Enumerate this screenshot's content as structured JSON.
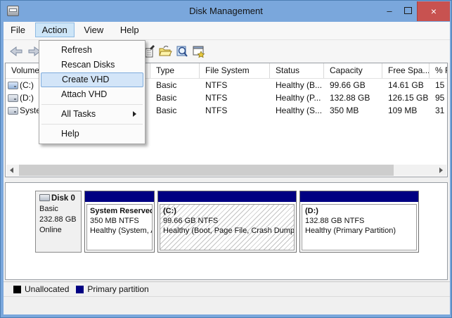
{
  "window": {
    "title": "Disk Management",
    "controls": {
      "minimize": "–",
      "maximize": "maximize-box",
      "close": "×"
    }
  },
  "menu_bar": {
    "items": [
      {
        "label": "File"
      },
      {
        "label": "Action",
        "active": true
      },
      {
        "label": "View"
      },
      {
        "label": "Help"
      }
    ]
  },
  "action_menu": {
    "items": [
      {
        "label": "Refresh"
      },
      {
        "label": "Rescan Disks"
      },
      {
        "label": "Create VHD",
        "highlighted": true
      },
      {
        "label": "Attach VHD"
      },
      {
        "label": "All Tasks",
        "has_submenu": true
      },
      {
        "label": "Help"
      }
    ]
  },
  "toolbar": {
    "icons": [
      "back-arrow",
      "forward-arrow",
      "export-list",
      "open-folder",
      "find",
      "console-window"
    ]
  },
  "volume_list": {
    "columns": {
      "volume": "Volume",
      "type": "Type",
      "file_system": "File System",
      "status": "Status",
      "capacity": "Capacity",
      "free_space": "Free Spa...",
      "percent_free": "% Free"
    },
    "rows": [
      {
        "volume": "(C:)",
        "type": "Basic",
        "file_system": "NTFS",
        "status": "Healthy (B...",
        "capacity": "99.66 GB",
        "free_space": "14.61 GB",
        "percent_free": "15"
      },
      {
        "volume": "(D:)",
        "type": "Basic",
        "file_system": "NTFS",
        "status": "Healthy (P...",
        "capacity": "132.88 GB",
        "free_space": "126.15 GB",
        "percent_free": "95"
      },
      {
        "volume": "System Reserved",
        "type": "Basic",
        "file_system": "NTFS",
        "status": "Healthy (S...",
        "capacity": "350 MB",
        "free_space": "109 MB",
        "percent_free": "31"
      }
    ]
  },
  "disk_panel": {
    "disk_name": "Disk 0",
    "disk_type": "Basic",
    "disk_size": "232.88 GB",
    "disk_status": "Online",
    "partitions": [
      {
        "name": "System Reserved",
        "size": "350 MB NTFS",
        "status": "Healthy (System, Active, Primary Partition)",
        "hatched": false
      },
      {
        "name": "(C:)",
        "size": "99.66 GB NTFS",
        "status": "Healthy (Boot, Page File, Crash Dump, Primary Partition)",
        "hatched": true
      },
      {
        "name": "(D:)",
        "size": "132.88 GB NTFS",
        "status": "Healthy (Primary Partition)",
        "hatched": false
      }
    ]
  },
  "legend": {
    "items": [
      {
        "label": "Unallocated",
        "color": "#000000"
      },
      {
        "label": "Primary partition",
        "color": "#000082"
      }
    ]
  },
  "colors": {
    "titlebar": "#7aa7dc",
    "close_button": "#c85250",
    "partition_band": "#000082",
    "menu_highlight": "#d3e5f8"
  }
}
